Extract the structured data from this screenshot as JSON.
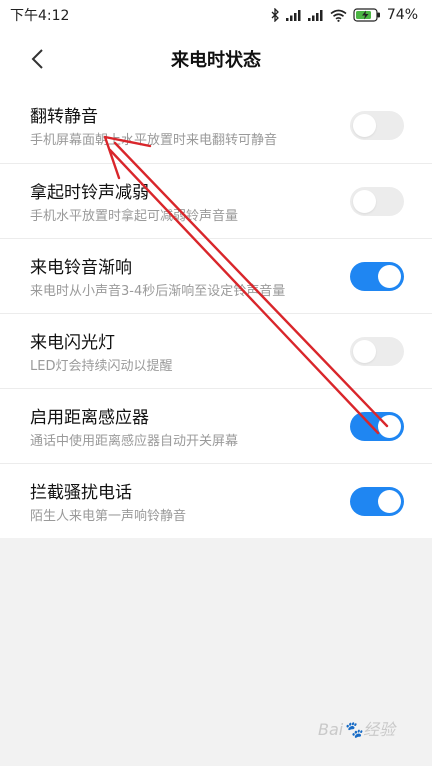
{
  "status_bar": {
    "time": "下午4:12",
    "battery_percent": "74%",
    "icons": [
      "bluetooth-icon",
      "signal-icon",
      "signal-icon",
      "wifi-icon",
      "battery-charging-icon"
    ]
  },
  "header": {
    "title": "来电时状态",
    "back_icon": "chevron-left-icon"
  },
  "settings": [
    {
      "title": "翻转静音",
      "subtitle": "手机屏幕面朝上水平放置时来电翻转可静音",
      "enabled": false
    },
    {
      "title": "拿起时铃声减弱",
      "subtitle": "手机水平放置时拿起可减弱铃声音量",
      "enabled": false
    },
    {
      "title": "来电铃音渐响",
      "subtitle": "来电时从小声音3-4秒后渐响至设定铃声音量",
      "enabled": true
    },
    {
      "title": "来电闪光灯",
      "subtitle": "LED灯会持续闪动以提醒",
      "enabled": false
    },
    {
      "title": "启用距离感应器",
      "subtitle": "通话中使用距离感应器自动开关屏幕",
      "enabled": true
    },
    {
      "title": "拦截骚扰电话",
      "subtitle": "陌生人来电第一声响铃静音",
      "enabled": true
    }
  ],
  "colors": {
    "accent": "#1f86f2",
    "annotation_arrow": "#d9262b"
  }
}
